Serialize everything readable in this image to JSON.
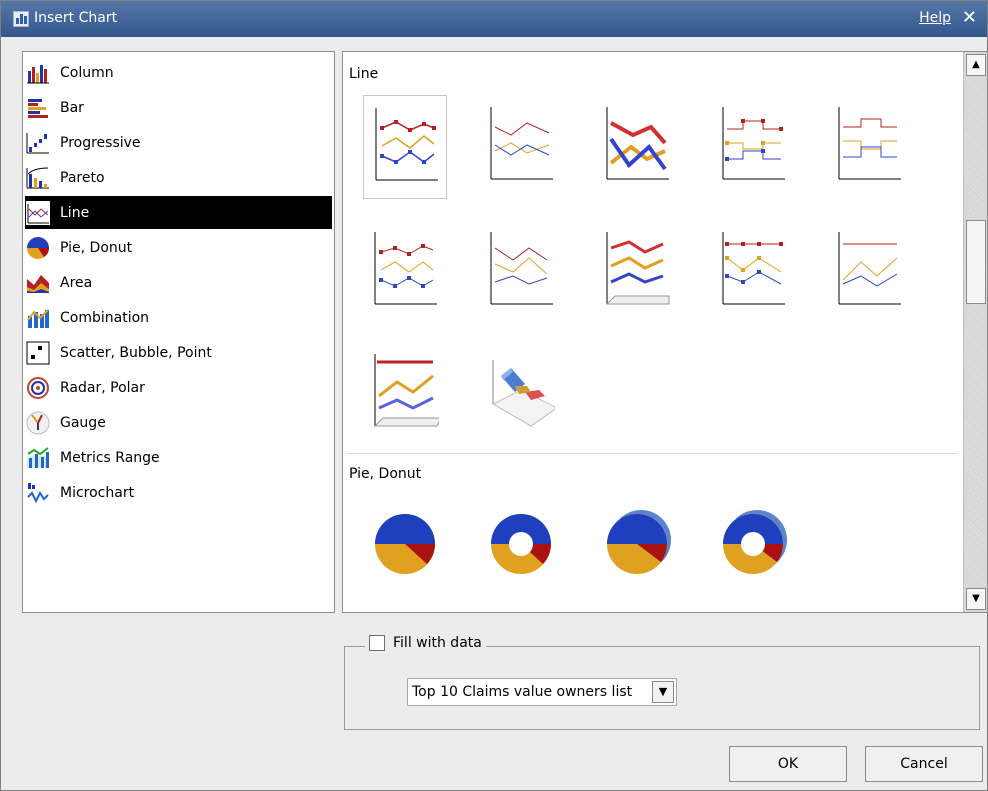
{
  "window": {
    "title": "Insert Chart",
    "help_label": "Help",
    "close_glyph": "✕"
  },
  "chart_types": {
    "items": [
      {
        "label": "Column",
        "icon": "column-chart-icon"
      },
      {
        "label": "Bar",
        "icon": "bar-chart-icon"
      },
      {
        "label": "Progressive",
        "icon": "progressive-chart-icon"
      },
      {
        "label": "Pareto",
        "icon": "pareto-chart-icon"
      },
      {
        "label": "Line",
        "icon": "line-chart-icon",
        "selected": true
      },
      {
        "label": "Pie, Donut",
        "icon": "pie-chart-icon"
      },
      {
        "label": "Area",
        "icon": "area-chart-icon"
      },
      {
        "label": "Combination",
        "icon": "combination-chart-icon"
      },
      {
        "label": "Scatter, Bubble, Point",
        "icon": "scatter-chart-icon"
      },
      {
        "label": "Radar, Polar",
        "icon": "radar-chart-icon"
      },
      {
        "label": "Gauge",
        "icon": "gauge-chart-icon"
      },
      {
        "label": "Metrics Range",
        "icon": "metrics-range-icon"
      },
      {
        "label": "Microchart",
        "icon": "microchart-icon"
      }
    ]
  },
  "gallery": {
    "sections": [
      {
        "label": "Line"
      },
      {
        "label": "Pie, Donut"
      }
    ]
  },
  "fill": {
    "checkbox_label": "Fill with data",
    "checked": false,
    "select_value": "Top 10 Claims value owners list"
  },
  "buttons": {
    "ok": "OK",
    "cancel": "Cancel"
  },
  "colors": {
    "selection": "#000000",
    "series_red": "#b22222",
    "series_gold": "#e0a020",
    "series_blue": "#3344cc",
    "titlebar": "#3f6296"
  }
}
